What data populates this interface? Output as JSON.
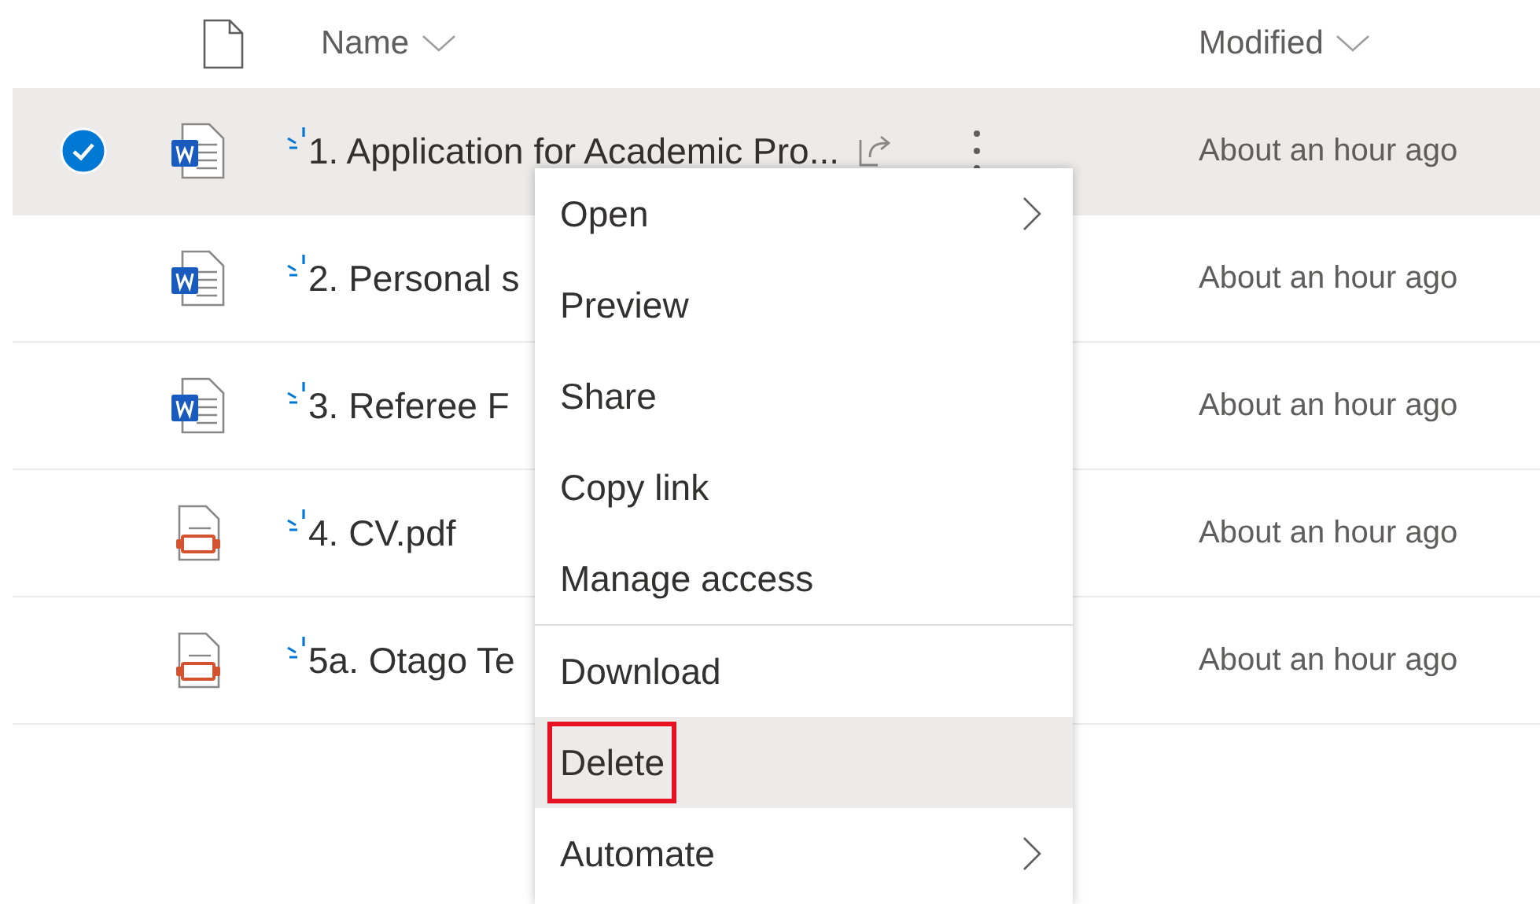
{
  "columns": [
    {
      "label": "Name"
    },
    {
      "label": "Modified"
    }
  ],
  "files": [
    {
      "kind": "word",
      "name": "1. Application for Academic Pro...",
      "modified": "About an hour ago",
      "selected": true
    },
    {
      "kind": "word",
      "name": "2. Personal s",
      "modified": "About an hour ago",
      "selected": false
    },
    {
      "kind": "word",
      "name": "3. Referee F",
      "modified": "About an hour ago",
      "selected": false
    },
    {
      "kind": "pdf",
      "name": "4. CV.pdf",
      "modified": "About an hour ago",
      "selected": false
    },
    {
      "kind": "pdf",
      "name": "5a. Otago Te",
      "modified": "About an hour ago",
      "selected": false
    }
  ],
  "context_menu": {
    "items": [
      {
        "label": "Open",
        "has_submenu": true,
        "divider_before": false,
        "hovered": false,
        "outlined": false
      },
      {
        "label": "Preview",
        "has_submenu": false,
        "divider_before": false,
        "hovered": false,
        "outlined": false
      },
      {
        "label": "Share",
        "has_submenu": false,
        "divider_before": false,
        "hovered": false,
        "outlined": false
      },
      {
        "label": "Copy link",
        "has_submenu": false,
        "divider_before": false,
        "hovered": false,
        "outlined": false
      },
      {
        "label": "Manage access",
        "has_submenu": false,
        "divider_before": false,
        "hovered": false,
        "outlined": false
      },
      {
        "label": "Download",
        "has_submenu": false,
        "divider_before": true,
        "hovered": false,
        "outlined": false
      },
      {
        "label": "Delete",
        "has_submenu": false,
        "divider_before": false,
        "hovered": true,
        "outlined": true
      },
      {
        "label": "Automate",
        "has_submenu": true,
        "divider_before": false,
        "hovered": false,
        "outlined": false
      }
    ]
  }
}
